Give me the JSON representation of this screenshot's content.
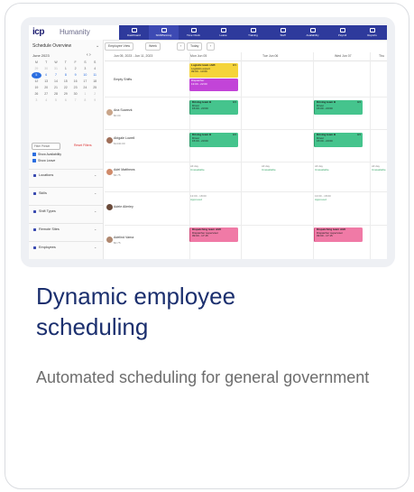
{
  "card": {
    "title": "Dynamic employee scheduling",
    "description": "Automated scheduling for general government"
  },
  "app": {
    "logo": "icp",
    "brand": "Humanity",
    "nav": [
      "Dashboard",
      "ShiftPlanning",
      "Time Clock",
      "Leave",
      "Training",
      "Staff",
      "Availability",
      "Payroll",
      "Reports"
    ],
    "active_nav": "ShiftPlanning",
    "accent": "#2e3a9c"
  },
  "left_panel": {
    "title": "Schedule Overview",
    "month": "June 2023",
    "weekdays": [
      "M",
      "T",
      "W",
      "T",
      "F",
      "S",
      "S"
    ],
    "weeks": [
      [
        "29",
        "30",
        "31",
        "1",
        "2",
        "3",
        "4"
      ],
      [
        "5",
        "6",
        "7",
        "8",
        "9",
        "10",
        "11"
      ],
      [
        "12",
        "13",
        "14",
        "15",
        "16",
        "17",
        "18"
      ],
      [
        "19",
        "20",
        "21",
        "22",
        "23",
        "24",
        "25"
      ],
      [
        "26",
        "27",
        "28",
        "29",
        "30",
        "1",
        "2"
      ],
      [
        "3",
        "4",
        "5",
        "6",
        "7",
        "8",
        "9"
      ]
    ],
    "selected_day": "5",
    "filter_placeholder": "Filter Preset",
    "reset_filters": "Reset Filters",
    "show_availability": "Show Availability",
    "show_leave": "Show Leave",
    "sections": [
      "Locations",
      "Skills",
      "Shift Types",
      "Remote Sites",
      "Employees"
    ]
  },
  "toolbar": {
    "view": "Employee View",
    "range": "Week",
    "today": "Today"
  },
  "grid": {
    "range_label": "Jun 05, 2023 - Jun 11, 2023",
    "days": [
      "Mon Jun 05",
      "Tue Jun 06",
      "Wed Jun 07",
      "Thu"
    ],
    "rows": [
      {
        "name": "Empty Shifts",
        "sub": ""
      },
      {
        "name": "Ana Suarezk",
        "sub": "$0.00"
      },
      {
        "name": "Abigale Lowell",
        "sub": "$1440.00"
      },
      {
        "name": "Adel Matthews",
        "sub": "$4.75"
      },
      {
        "name": "Adele Allerley",
        "sub": ""
      },
      {
        "name": "Adelind Varna",
        "sub": "$0.75"
      }
    ],
    "shifts": {
      "logistic": {
        "title": "Logistic team shift",
        "role": "Logistics expert",
        "time": "09:00 - 13:00",
        "count": "0/1"
      },
      "dispatcher": {
        "title": "Dispatcher",
        "time": "13:00 - 22:00"
      },
      "driving": {
        "title": "Driving team B",
        "role": "Driver",
        "time": "15:00 - 23:00",
        "count": "0/4"
      },
      "dispatching": {
        "title": "Dispatching team shift",
        "role": "Dispatcher supervisor",
        "time": "09:00 - 17:15"
      }
    },
    "notes": {
      "all_day": "All day",
      "unavailable": "Unavailable",
      "preferred": "13:00 - 18:00",
      "approved": "Approved"
    }
  }
}
